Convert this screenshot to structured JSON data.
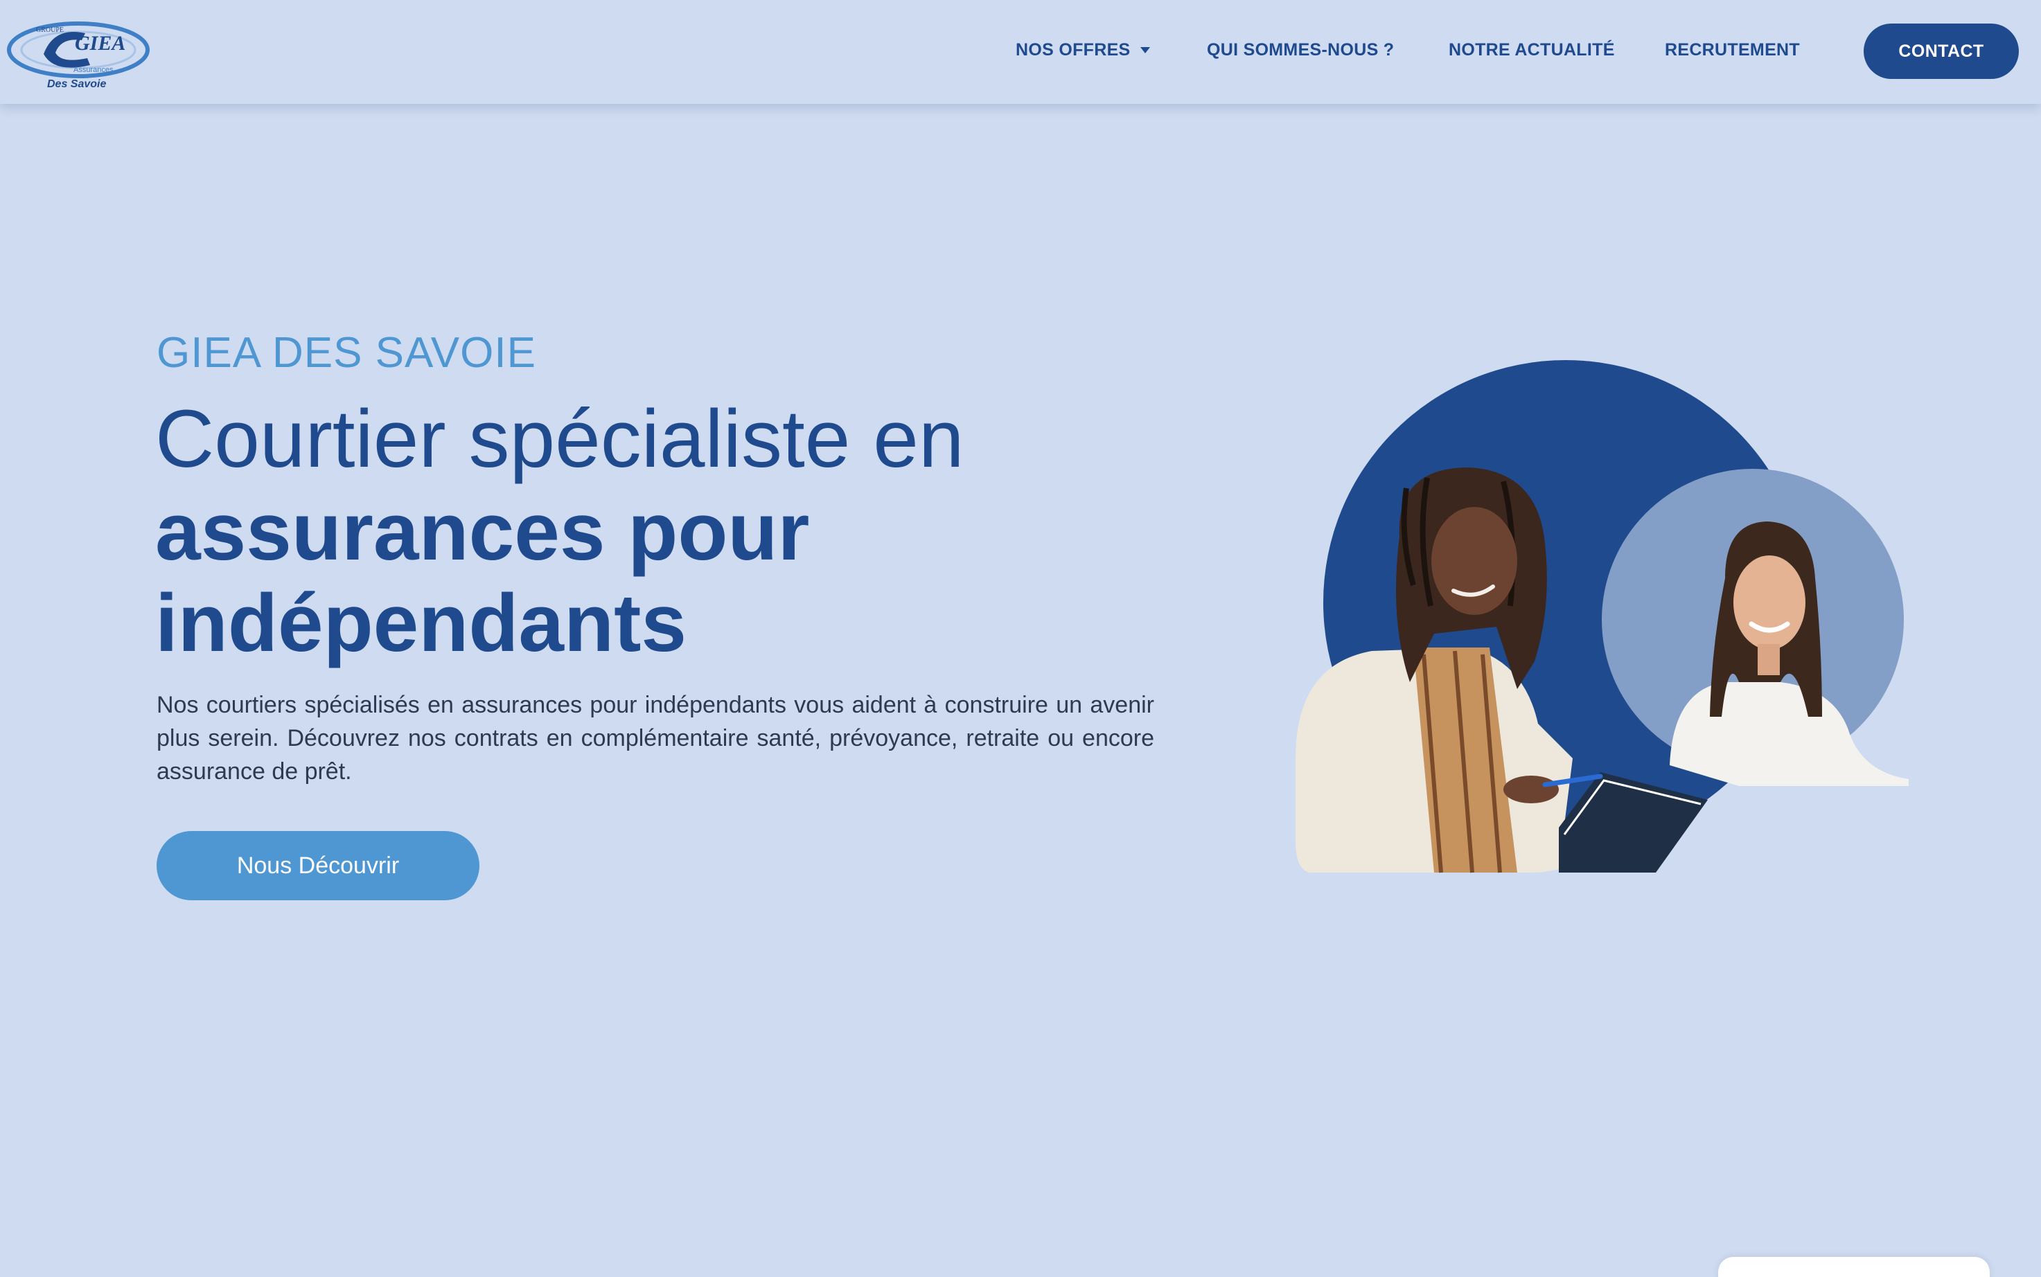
{
  "header": {
    "logo": {
      "text_main": "GIEA",
      "text_group": "GROUPE",
      "text_assurances": "Assurances",
      "text_subtitle": "Des Savoie"
    },
    "nav": [
      {
        "label": "NOS OFFRES",
        "has_dropdown": true
      },
      {
        "label": "QUI SOMMES-NOUS ?"
      },
      {
        "label": "NOTRE ACTUALITÉ"
      },
      {
        "label": "RECRUTEMENT"
      }
    ],
    "contact_label": "CONTACT"
  },
  "hero": {
    "eyebrow": "GIEA DES SAVOIE",
    "title_line1": "Courtier spécialiste en",
    "title_line2": "assurances pour",
    "title_line3": "indépendants",
    "description": "Nos courtiers spécialisés en assurances pour indépendants vous aident à construire un avenir plus serein. Découvrez nos contrats en complémentaire santé, prévoyance, retraite ou encore assurance de prêt.",
    "cta_label": "Nous Découvrir"
  },
  "colors": {
    "background": "#cfdbf1",
    "primary": "#1f4a8d",
    "accent": "#4e97d2",
    "secondary_circle": "#839fc8"
  }
}
